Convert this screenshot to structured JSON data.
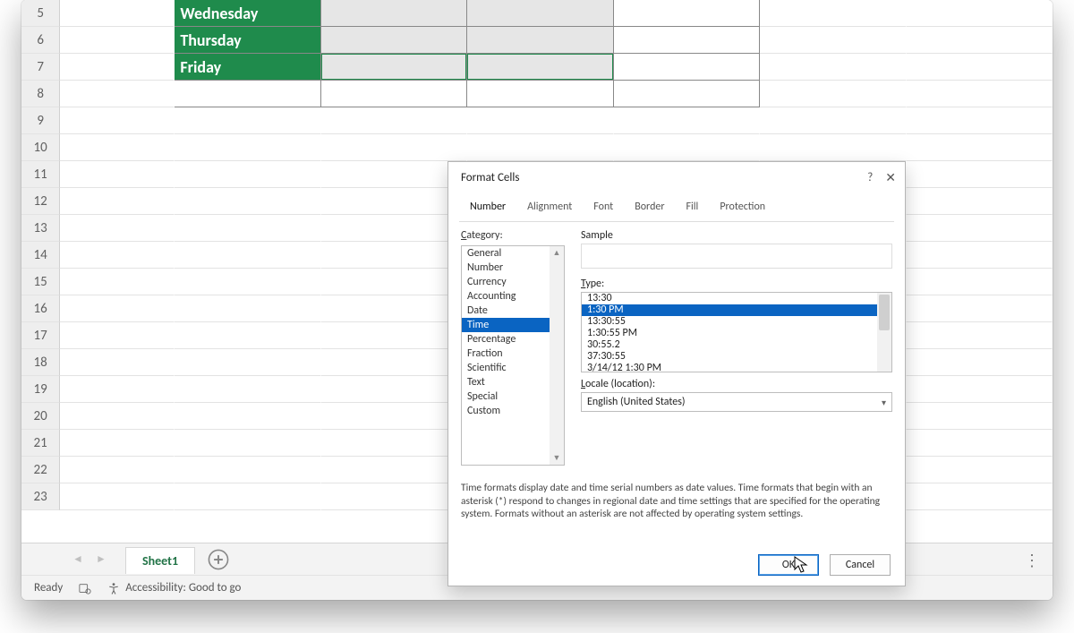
{
  "rows": {
    "headers": [
      "5",
      "6",
      "7",
      "8",
      "9",
      "10",
      "11",
      "12",
      "13",
      "14",
      "15",
      "16",
      "17",
      "18",
      "19",
      "20",
      "21",
      "22",
      "23"
    ],
    "days": [
      "Wednesday",
      "Thursday",
      "Friday"
    ]
  },
  "tab": {
    "sheet_name": "Sheet1"
  },
  "status": {
    "ready": "Ready",
    "accessibility": "Accessibility: Good to go"
  },
  "dialog": {
    "title": "Format Cells",
    "tabs": [
      "Number",
      "Alignment",
      "Font",
      "Border",
      "Fill",
      "Protection"
    ],
    "active_tab": "Number",
    "category_label": "Category:",
    "categories": [
      "General",
      "Number",
      "Currency",
      "Accounting",
      "Date",
      "Time",
      "Percentage",
      "Fraction",
      "Scientific",
      "Text",
      "Special",
      "Custom"
    ],
    "category_selected": "Time",
    "sample_label": "Sample",
    "type_label": "Type:",
    "types": [
      "13:30",
      "1:30 PM",
      "13:30:55",
      "1:30:55 PM",
      "30:55.2",
      "37:30:55",
      "3/14/12 1:30 PM"
    ],
    "type_selected": "1:30 PM",
    "locale_label": "Locale (location):",
    "locale_value": "English (United States)",
    "help_text": "Time formats display date and time serial numbers as date values.  Time formats that begin with an asterisk (*) respond to changes in regional date and time settings that are specified for the operating system. Formats without an asterisk are not affected by operating system settings.",
    "ok": "OK",
    "cancel": "Cancel"
  }
}
